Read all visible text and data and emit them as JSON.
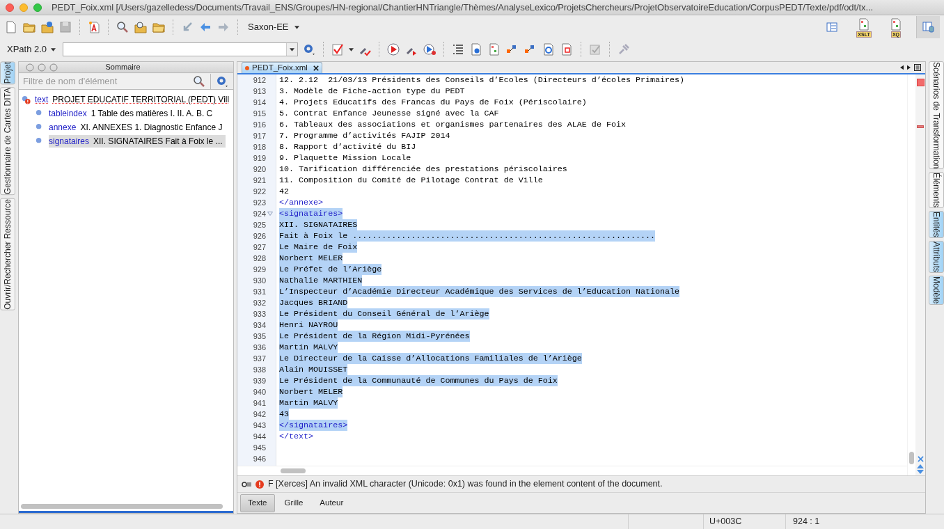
{
  "window": {
    "title": "PEDT_Foix.xml [/Users/gazelledess/Documents/Travail_ENS/Groupes/HN-regional/ChantierHNTriangle/Thèmes/AnalyseLexico/ProjetsChercheurs/ProjetObservatoireEducation/CorpusPEDT/Texte/pdf/odt/tx..."
  },
  "toolbar": {
    "transformer": "Saxon-EE",
    "xpath_version": "XPath 2.0",
    "perspectives": [
      {
        "selected": false
      },
      {
        "label": "XSLT",
        "selected": false
      },
      {
        "label": "XQ",
        "selected": false
      },
      {
        "selected": true
      }
    ]
  },
  "left_tabs": [
    {
      "label": "Projet",
      "selected": true
    },
    {
      "label": "Gestionnaire de Cartes DITA",
      "selected": false
    },
    {
      "label": "Ouvrir/Rechercher Ressource",
      "selected": false
    }
  ],
  "outline": {
    "title": "Sommaire",
    "filter_placeholder": "Filtre de nom d'élément",
    "items": [
      {
        "tag": "text",
        "text": "PROJET EDUCATIF TERRITORIAL (PEDT) Vill",
        "error": true,
        "selected": false,
        "children": [
          {
            "tag": "tableindex",
            "text": "1 Table des matières I. II. A. B. C",
            "error": false,
            "selected": false
          },
          {
            "tag": "annexe",
            "text": "XI. ANNEXES 1. Diagnostic Enfance J",
            "error": false,
            "selected": false
          },
          {
            "tag": "signataires",
            "text": "XII. SIGNATAIRES Fait à Foix le ...",
            "error": false,
            "selected": true
          }
        ]
      }
    ]
  },
  "editor": {
    "tabs": [
      {
        "label": "PEDT_Foix.xml",
        "modified": true,
        "selected": true
      }
    ],
    "lines": [
      {
        "n": "912",
        "text": "12. 2.12  21/03/13 Présidents des Conseils d’Ecoles (Directeurs d’écoles Primaires)",
        "kind": "text",
        "selected": false
      },
      {
        "n": "913",
        "text": "3. Modèle de Fiche-action type du PEDT",
        "kind": "text",
        "selected": false
      },
      {
        "n": "914",
        "text": "4. Projets Educatifs des Francas du Pays de Foix (Périscolaire)",
        "kind": "text",
        "selected": false
      },
      {
        "n": "915",
        "text": "5. Contrat Enfance Jeunesse signé avec la CAF",
        "kind": "text",
        "selected": false
      },
      {
        "n": "916",
        "text": "6. Tableaux des associations et organismes partenaires des ALAE de Foix",
        "kind": "text",
        "selected": false
      },
      {
        "n": "917",
        "text": "7. Programme d’activités FAJIP 2014",
        "kind": "text",
        "selected": false
      },
      {
        "n": "918",
        "text": "8. Rapport d’activité du BIJ",
        "kind": "text",
        "selected": false
      },
      {
        "n": "919",
        "text": "9. Plaquette Mission Locale",
        "kind": "text",
        "selected": false
      },
      {
        "n": "920",
        "text": "10. Tarification différenciée des prestations périscolaires",
        "kind": "text",
        "selected": false
      },
      {
        "n": "921",
        "text": "11. Composition du Comité de Pilotage Contrat de Ville",
        "kind": "text",
        "selected": false
      },
      {
        "n": "922",
        "text": "42",
        "kind": "text",
        "selected": false
      },
      {
        "n": "923",
        "text": "</annexe>",
        "kind": "tag",
        "selected": false
      },
      {
        "n": "924",
        "text": "<signataires>",
        "kind": "tag",
        "selected": true,
        "foldable": true
      },
      {
        "n": "925",
        "text": "XII. SIGNATAIRES",
        "kind": "text",
        "selected": true
      },
      {
        "n": "926",
        "text": "Fait à Foix le ..............................................................",
        "kind": "text",
        "selected": true
      },
      {
        "n": "927",
        "text": "Le Maire de Foix",
        "kind": "text",
        "selected": true
      },
      {
        "n": "928",
        "text": "Norbert MELER",
        "kind": "text",
        "selected": true
      },
      {
        "n": "929",
        "text": "Le Préfet de l’Ariège",
        "kind": "text",
        "selected": true
      },
      {
        "n": "930",
        "text": "Nathalie MARTHIEN",
        "kind": "text",
        "selected": true
      },
      {
        "n": "931",
        "text": "L’Inspecteur d’Académie Directeur Académique des Services de l’Education Nationale",
        "kind": "text",
        "selected": true
      },
      {
        "n": "932",
        "text": "Jacques BRIAND",
        "kind": "text",
        "selected": true
      },
      {
        "n": "933",
        "text": "Le Président du Conseil Général de l’Ariège",
        "kind": "text",
        "selected": true
      },
      {
        "n": "934",
        "text": "Henri NAYROU",
        "kind": "text",
        "selected": true
      },
      {
        "n": "935",
        "text": "Le Président de la Région Midi-Pyrénées",
        "kind": "text",
        "selected": true
      },
      {
        "n": "936",
        "text": "Martin MALVY",
        "kind": "text",
        "selected": true
      },
      {
        "n": "937",
        "text": "Le Directeur de la Caisse d’Allocations Familiales de l’Ariège",
        "kind": "text",
        "selected": true
      },
      {
        "n": "938",
        "text": "Alain MOUISSET",
        "kind": "text",
        "selected": true
      },
      {
        "n": "939",
        "text": "Le Président de la Communauté de Communes du Pays de Foix",
        "kind": "text",
        "selected": true
      },
      {
        "n": "940",
        "text": "Norbert MELER",
        "kind": "text",
        "selected": true
      },
      {
        "n": "941",
        "text": "Martin MALVY",
        "kind": "text",
        "selected": true
      },
      {
        "n": "942",
        "text": "43",
        "kind": "text",
        "selected": true
      },
      {
        "n": "943",
        "text": "</signataires>",
        "kind": "tag",
        "selected": true
      },
      {
        "n": "944",
        "text": "</text>",
        "kind": "tag",
        "selected": false
      },
      {
        "n": "945"
      },
      {
        "n": "946"
      }
    ],
    "message": {
      "text": "F [Xerces] An invalid XML character (Unicode: 0x1) was found in the element content of the document."
    },
    "modes": [
      {
        "label": "Texte",
        "selected": true
      },
      {
        "label": "Grille",
        "selected": false
      },
      {
        "label": "Auteur",
        "selected": false
      }
    ]
  },
  "right_tabs": [
    {
      "label": "Scénarios de Transformation",
      "selected": false
    },
    {
      "label": "Éléments",
      "selected": false
    },
    {
      "label": "Entités",
      "selected": true
    },
    {
      "label": "Attributs",
      "selected": true
    },
    {
      "label": "Modèle",
      "selected": true
    }
  ],
  "status_bar": {
    "character": "U+003C",
    "position": "924 : 1"
  }
}
